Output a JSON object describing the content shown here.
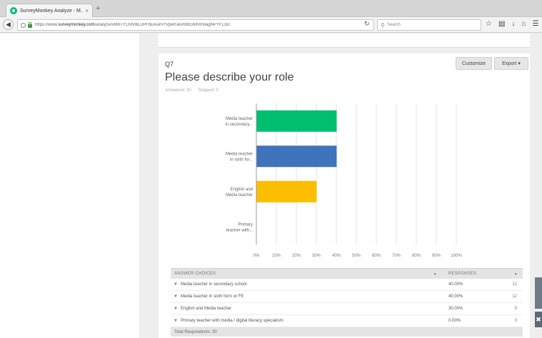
{
  "browser": {
    "tab_title": "SurveyMonkey Analyze - M...",
    "tab_close": "×",
    "new_tab": "+",
    "url_prefix": "https://www.",
    "url_domain": "surveymonkey.com",
    "url_path": "/analyze/vM8TYCMV8iL2PFbDAumYVpeIfJesRBtG6lhXNtagNPYFL3D",
    "search_placeholder": "Search"
  },
  "question": {
    "number": "Q7",
    "title": "Please describe your role",
    "answered": "Answered: 30",
    "skipped": "Skipped: 0"
  },
  "buttons": {
    "customize": "Customize",
    "export": "Export ▾"
  },
  "chart_data": {
    "type": "bar",
    "orientation": "horizontal",
    "categories": [
      "Media teacher in secondary...",
      "Media teacher in sixth for...",
      "English and Media teacher",
      "Primary teacher with..."
    ],
    "values": [
      40,
      40,
      30,
      0
    ],
    "colors": [
      "#00bf6f",
      "#3f74bd",
      "#fbbf00",
      "#b9b9b9"
    ],
    "xticks": [
      "0%",
      "10%",
      "20%",
      "30%",
      "40%",
      "50%",
      "60%",
      "70%",
      "80%",
      "90%",
      "100%"
    ],
    "xlim": [
      0,
      100
    ],
    "grid": true
  },
  "table": {
    "header_choices": "ANSWER CHOICES",
    "header_responses": "RESPONSES",
    "header_sort": "▾",
    "rows": [
      {
        "choice": "Media teacher in secondary school",
        "pct": "40.00%",
        "count": "12"
      },
      {
        "choice": "Media teacher in sixth form or FE",
        "pct": "40.00%",
        "count": "12"
      },
      {
        "choice": "English and Media teacher",
        "pct": "30.00%",
        "count": "9"
      },
      {
        "choice": "Primary teacher with media / digital literacy specialism",
        "pct": "0.00%",
        "count": "0"
      }
    ],
    "footer": "Total Respondents: 30"
  }
}
